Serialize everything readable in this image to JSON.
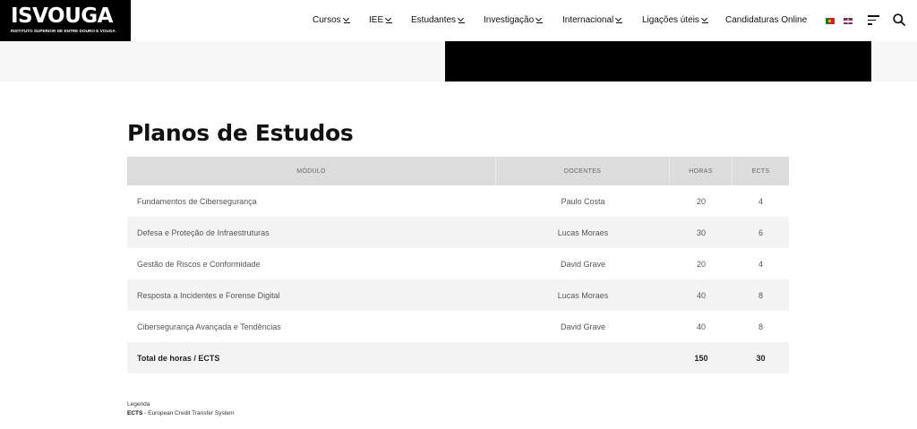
{
  "header": {
    "logo_text": "ISVOUGA",
    "logo_subtitle": "INSTITUTO SUPERIOR DE ENTRE DOURO E VOUGA",
    "nav": [
      {
        "label": "Cursos",
        "dropdown": true
      },
      {
        "label": "IEE",
        "dropdown": true
      },
      {
        "label": "Estudantes",
        "dropdown": true
      },
      {
        "label": "Investigação",
        "dropdown": true
      },
      {
        "label": "Internacional",
        "dropdown": true
      },
      {
        "label": "Ligações úteis",
        "dropdown": true
      },
      {
        "label": "Candidaturas Online",
        "dropdown": false
      }
    ],
    "languages": [
      "pt",
      "en"
    ]
  },
  "main": {
    "title": "Planos de Estudos",
    "table": {
      "headers": [
        "MÓDULO",
        "DOCENTES",
        "HORAS",
        "ECTS"
      ],
      "rows": [
        {
          "modulo": "Fundamentos de Cibersegurança",
          "docente": "Paulo Costa",
          "horas": "20",
          "ects": "4"
        },
        {
          "modulo": "Defesa e Proteção de Infraestruturas",
          "docente": "Lucas Moraes",
          "horas": "30",
          "ects": "6"
        },
        {
          "modulo": "Gestão de Riscos e Conformidade",
          "docente": "David Grave",
          "horas": "20",
          "ects": "4"
        },
        {
          "modulo": "Resposta a Incidentes e Forense Digital",
          "docente": "Lucas Moraes",
          "horas": "40",
          "ects": "8"
        },
        {
          "modulo": "Cibersegurança Avançada e Tendências",
          "docente": "David Grave",
          "horas": "40",
          "ects": "8"
        }
      ],
      "total": {
        "label": "Total de horas / ECTS",
        "horas": "150",
        "ects": "30"
      }
    },
    "legend": {
      "title": "Legenda",
      "term": "ECTS",
      "definition": " - European Credit Transfer System"
    }
  },
  "colors": {
    "header_bg": "#ffffff",
    "logo_bg": "#000000",
    "table_header_bg": "#dcdcdc",
    "row_alt_bg": "#f4f4f4",
    "banner_bg": "#f7f7f7"
  }
}
